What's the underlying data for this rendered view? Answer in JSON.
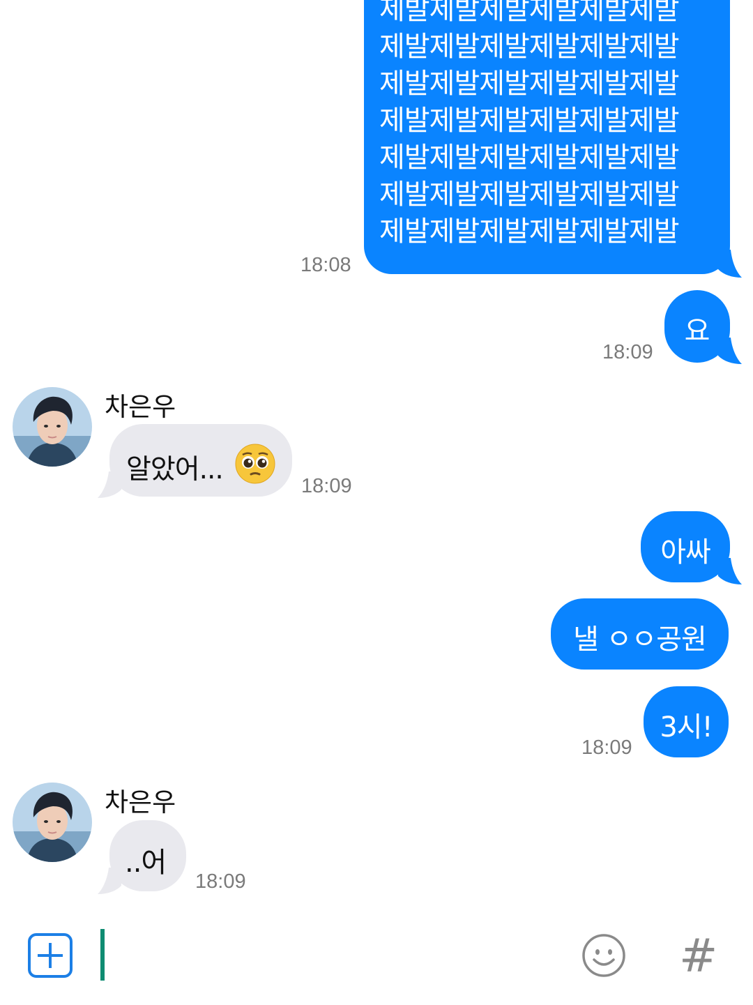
{
  "colors": {
    "outgoing_bubble": "#0a84ff",
    "incoming_bubble": "#e9e9ee",
    "timestamp": "#7a7a7a",
    "accent_plus": "#1c7fe6",
    "cursor": "#0f8c72"
  },
  "messages": {
    "m1": {
      "lines": [
        "제발제발제발제발제발제발",
        "제발제발제발제발제발제발",
        "제발제발제발제발제발제발",
        "제발제발제발제발제발제발",
        "제발제발제발제발제발제발",
        "제발제발제발제발제발제발",
        "제발제발제발제발제발제발"
      ],
      "time": "18:08"
    },
    "m2": {
      "text": "요",
      "time": "18:09"
    },
    "m3": {
      "sender": "차은우",
      "text": "알았어...",
      "emoji": "pleading-face",
      "time": "18:09"
    },
    "m4": {
      "text": "아싸"
    },
    "m5": {
      "text": "낼 ㅇㅇ공원"
    },
    "m6": {
      "text": "3시!",
      "time": "18:09"
    },
    "m7": {
      "sender": "차은우",
      "text": "..어",
      "time": "18:09"
    }
  },
  "composer": {
    "attach_icon": "plus-square-icon",
    "emoji_icon": "smiley-icon",
    "hashtag_icon": "hashtag-icon",
    "hashtag_glyph": "#"
  }
}
